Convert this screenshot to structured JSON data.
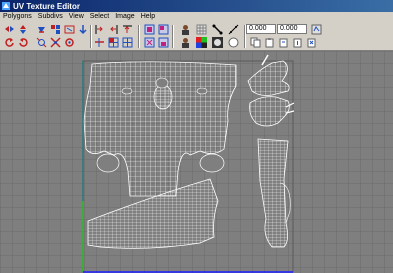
{
  "window": {
    "title": "UV Texture Editor"
  },
  "menu": [
    "Polygons",
    "Subdivs",
    "View",
    "Select",
    "Image",
    "Help"
  ],
  "toolbar": {
    "icons_row1": [
      "flip-u-icon",
      "flip-v-icon",
      "rotate-uv-icon",
      "cut-uv-icon",
      "sew-uv-icon",
      "unfold-icon",
      "move-down-icon",
      "align-left-icon",
      "align-right-icon",
      "align-top-icon",
      "snapshot-icon",
      "grid-toggle-icon",
      "isolate-icon",
      "frame-all-icon",
      "image-toggle-icon",
      "pixel-snap-icon"
    ],
    "icons_row2": [
      "rotate-ccw-icon",
      "rotate-cw-icon",
      "split-uv-icon",
      "merge-uv-icon",
      "layout-icon",
      "relax-icon",
      "grid-uv-icon",
      "stack-icon",
      "texture-toggle-icon",
      "shade-icon",
      "filter-icon",
      "dim-icon",
      "copy-uv-icon",
      "paste-uv-icon",
      "paste-u-icon",
      "paste-v-icon"
    ],
    "u_value": "0.000",
    "v_value": "0.000"
  },
  "viewport": {
    "background": "#7f7f7f",
    "grid_color": "#6b6b6b",
    "wire_color": "#ffffff",
    "u_axis_color": "#2020ff",
    "v_axis_color": "#20c020"
  }
}
